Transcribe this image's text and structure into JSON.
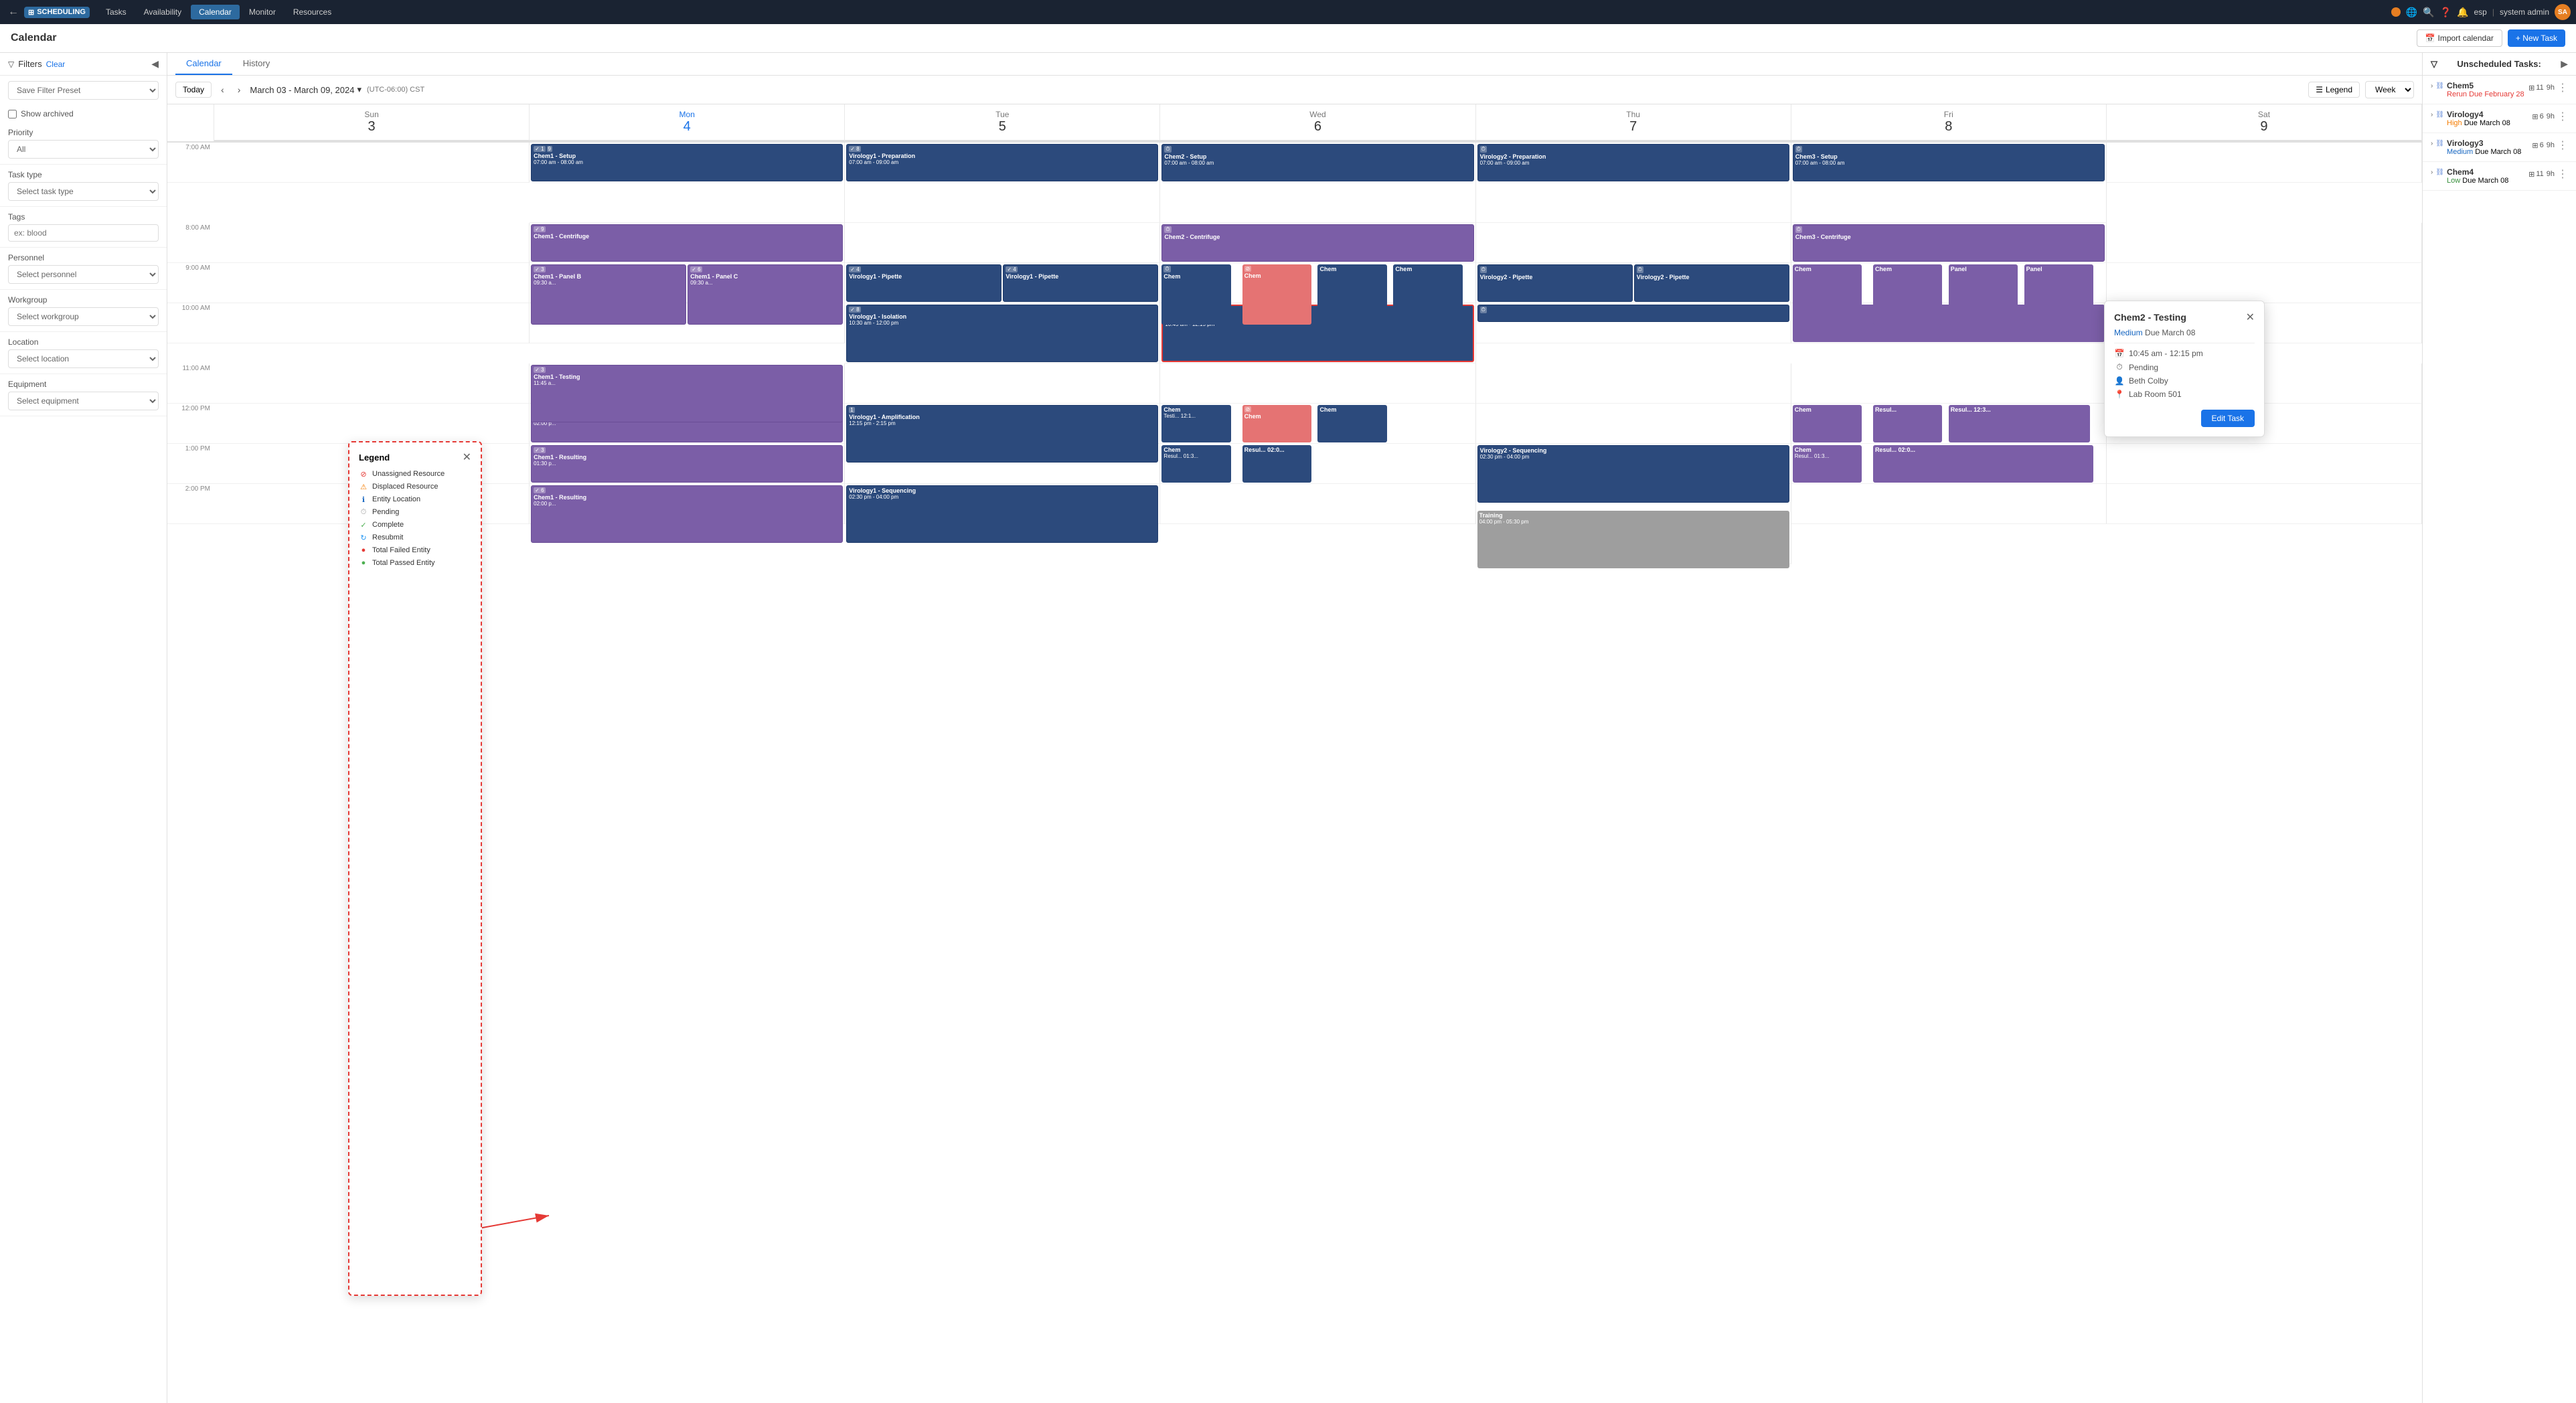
{
  "nav": {
    "logo_icon": "⊞",
    "logo_text": "SCHEDULING",
    "tabs": [
      "Tasks",
      "Availability",
      "Calendar",
      "Monitor",
      "Resources"
    ],
    "active_tab": "Calendar",
    "lang": "esp",
    "user": "system admin"
  },
  "page": {
    "title": "Calendar",
    "import_btn": "Import calendar",
    "new_task_btn": "+ New Task"
  },
  "sidebar": {
    "filters_label": "Filters",
    "clear_label": "Clear",
    "preset_placeholder": "Save Filter Preset",
    "show_archived": "Show archived",
    "priority_label": "Priority",
    "priority_value": "All",
    "task_type_label": "Task type",
    "task_type_placeholder": "Select task type",
    "tags_label": "Tags",
    "tags_placeholder": "ex: blood",
    "personnel_label": "Personnel",
    "personnel_placeholder": "Select personnel",
    "workgroup_label": "Workgroup",
    "workgroup_placeholder": "Select workgroup",
    "location_label": "Location",
    "location_placeholder": "Select location",
    "equipment_label": "Equipment",
    "equipment_placeholder": "Select equipment"
  },
  "calendar": {
    "tabs": [
      "Calendar",
      "History"
    ],
    "active_tab": "Calendar",
    "today_btn": "Today",
    "date_range": "March 03 - March 09, 2024",
    "timezone": "(UTC-06:00) CST",
    "legend_btn": "Legend",
    "view_btn": "Week",
    "days": [
      {
        "name": "Sun",
        "num": "3"
      },
      {
        "name": "Mon",
        "num": "4"
      },
      {
        "name": "Tue",
        "num": "5"
      },
      {
        "name": "Wed",
        "num": "6"
      },
      {
        "name": "Thu",
        "num": "7"
      },
      {
        "name": "Fri",
        "num": "8"
      },
      {
        "name": "Sat",
        "num": "9"
      }
    ],
    "time_slots": [
      "7:00 AM",
      "8:00 AM",
      "9:00 AM",
      "10:00 AM",
      "11:00 AM",
      "12:00 PM",
      "1:00 PM"
    ]
  },
  "legend_popup": {
    "title": "Legend",
    "items": [
      {
        "icon": "⊘",
        "label": "Unassigned Resource",
        "class": "legend-unassigned"
      },
      {
        "icon": "⚠",
        "label": "Displaced Resource",
        "class": "legend-displaced"
      },
      {
        "icon": "i",
        "label": "Entity Location",
        "class": "legend-entity"
      },
      {
        "icon": "⏱",
        "label": "Pending",
        "class": "legend-pending"
      },
      {
        "icon": "✓",
        "label": "Complete",
        "class": "legend-complete"
      },
      {
        "icon": "↻",
        "label": "Resubmit",
        "class": "legend-resubmit"
      },
      {
        "icon": "●",
        "label": "Total Failed Entity",
        "class": "legend-failed"
      },
      {
        "icon": "●",
        "label": "Total Passed Entity",
        "class": "legend-passed"
      }
    ]
  },
  "task_popup": {
    "title": "Chem2 - Testing",
    "priority": "Medium",
    "due": "Due March 08",
    "time": "10:45 am - 12:15 pm",
    "status": "Pending",
    "person": "Beth Colby",
    "location": "Lab Room 501",
    "edit_btn": "Edit Task"
  },
  "unscheduled": {
    "header": "Unscheduled Tasks:",
    "items": [
      {
        "name": "Chem5",
        "status_type": "Rerun",
        "status_color": "rerun",
        "due": "Due February 28",
        "entities": "11",
        "hours": "9h"
      },
      {
        "name": "Virology4",
        "status_type": "High",
        "status_color": "high",
        "due": "Due March 08",
        "entities": "6",
        "hours": "9h"
      },
      {
        "name": "Virology3",
        "status_type": "Medium",
        "status_color": "medium",
        "due": "Due March 08",
        "entities": "6",
        "hours": "9h"
      },
      {
        "name": "Chem4",
        "status_type": "Low",
        "status_color": "low",
        "due": "Due March 08",
        "entities": "11",
        "hours": "9h"
      }
    ]
  }
}
